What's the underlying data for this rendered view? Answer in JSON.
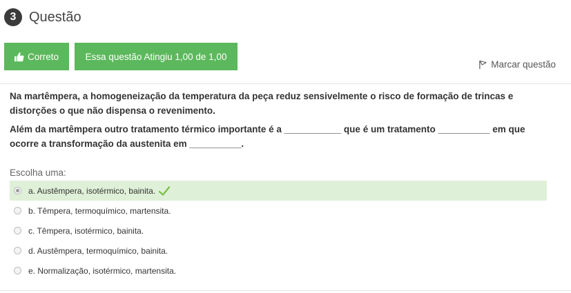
{
  "question": {
    "number": "3",
    "title": "Questão"
  },
  "status": {
    "result_label": "Correto",
    "score_label": "Essa questão Atingiu 1,00 de 1,00",
    "colors": {
      "success": "#5cb85c",
      "correct_bg": "#dff0d8",
      "check": "#7cc14c"
    }
  },
  "flag": {
    "label": "Marcar questão"
  },
  "prompt": {
    "paragraph1": "Na martêmpera, a homogeneização da temperatura da peça reduz sensivelmente o risco de formação de trincas e distorções o que não dispensa o revenimento.",
    "paragraph2": "Além da martêmpera outro tratamento térmico importante é a ___________ que é um tratamento __________ em que ocorre a transformação da austenita em __________."
  },
  "choose_label": "Escolha uma:",
  "answers": [
    {
      "label": "a. Austêmpera, isotérmico, bainita.",
      "selected": true,
      "correct": true
    },
    {
      "label": "b. Têmpera, termoquímico, martensita.",
      "selected": false,
      "correct": false
    },
    {
      "label": "c. Têmpera, isotérmico, bainita.",
      "selected": false,
      "correct": false
    },
    {
      "label": "d. Austêmpera, termoquímico, bainita.",
      "selected": false,
      "correct": false
    },
    {
      "label": "e. Normalização, isotérmico, martensita.",
      "selected": false,
      "correct": false
    }
  ],
  "icons": {
    "thumb": "thumbs-up-icon",
    "flag": "flag-icon",
    "check": "check-icon"
  }
}
